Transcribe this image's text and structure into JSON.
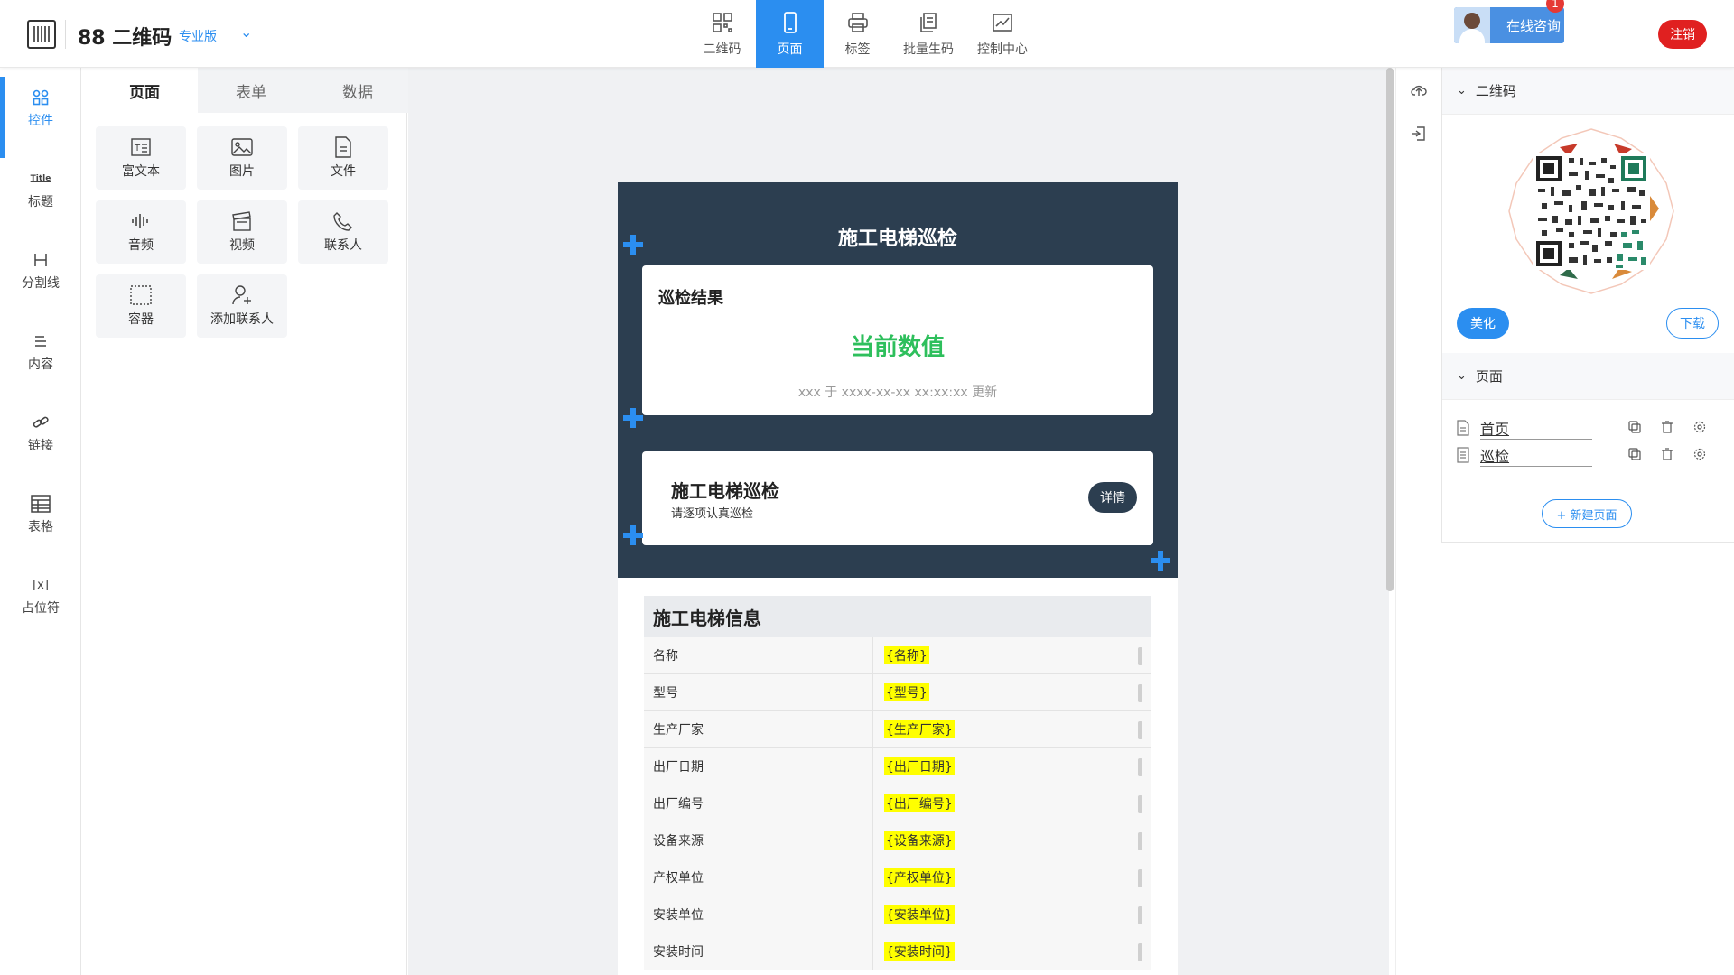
{
  "header": {
    "brand": "88 二维码",
    "edition": "专业版",
    "nav": [
      {
        "label": "二维码",
        "icon": "qrcode-icon"
      },
      {
        "label": "页面",
        "icon": "phone-page-icon",
        "active": true
      },
      {
        "label": "标签",
        "icon": "printer-icon"
      },
      {
        "label": "批量生码",
        "icon": "batch-docs-icon"
      },
      {
        "label": "控制中心",
        "icon": "chart-edit-icon"
      }
    ],
    "consult_label": "在线咨询",
    "consult_badge": "1",
    "logout_label": "注销",
    "accent_color": "#2b8ef0"
  },
  "left_rail": {
    "items": [
      {
        "label": "控件",
        "icon": "grid-icon",
        "active": true
      },
      {
        "label": "标题",
        "icon": "title-icon",
        "icon_text": "Title"
      },
      {
        "label": "分割线",
        "icon": "divider-icon"
      },
      {
        "label": "内容",
        "icon": "content-lines-icon"
      },
      {
        "label": "链接",
        "icon": "link-icon"
      },
      {
        "label": "表格",
        "icon": "table-icon"
      },
      {
        "label": "占位符",
        "icon": "placeholder-icon",
        "icon_text": "[x]"
      }
    ]
  },
  "widgets": {
    "tabs": [
      "页面",
      "表单",
      "数据"
    ],
    "active_tab": "页面",
    "items": [
      {
        "label": "富文本",
        "icon": "rich-text-icon"
      },
      {
        "label": "图片",
        "icon": "image-icon"
      },
      {
        "label": "文件",
        "icon": "file-icon"
      },
      {
        "label": "音频",
        "icon": "audio-wave-icon"
      },
      {
        "label": "视频",
        "icon": "video-clapper-icon"
      },
      {
        "label": "联系人",
        "icon": "phone-icon"
      },
      {
        "label": "容器",
        "icon": "container-icon"
      },
      {
        "label": "添加联系人",
        "icon": "add-contact-icon"
      }
    ]
  },
  "preview": {
    "title": "施工电梯巡检",
    "result_label": "巡检结果",
    "result_value": "当前数值",
    "result_update": "xxx 于 xxxx-xx-xx xx:xx:xx 更新",
    "card_title": "施工电梯巡检",
    "card_subtitle": "请逐项认真巡检",
    "detail_label": "详情",
    "table_title": "施工电梯信息",
    "rows": [
      {
        "key": "名称",
        "value": "{名称}"
      },
      {
        "key": "型号",
        "value": "{型号}"
      },
      {
        "key": "生产厂家",
        "value": "{生产厂家}"
      },
      {
        "key": "出厂日期",
        "value": "{出厂日期}"
      },
      {
        "key": "出厂编号",
        "value": "{出厂编号}"
      },
      {
        "key": "设备来源",
        "value": "{设备来源}"
      },
      {
        "key": "产权单位",
        "value": "{产权单位}"
      },
      {
        "key": "安装单位",
        "value": "{安装单位}"
      },
      {
        "key": "安装时间",
        "value": "{安装时间}"
      }
    ],
    "header_bg": "#2c3e50",
    "value_color": "#2ebf5c"
  },
  "right_panel": {
    "qr_section_title": "二维码",
    "beautify_label": "美化",
    "download_label": "下载",
    "page_section_title": "页面",
    "pages": [
      {
        "name": "首页",
        "icon": "page-doc-icon"
      },
      {
        "name": "巡检",
        "icon": "checklist-icon"
      }
    ],
    "new_page_label": "+ 新建页面"
  }
}
